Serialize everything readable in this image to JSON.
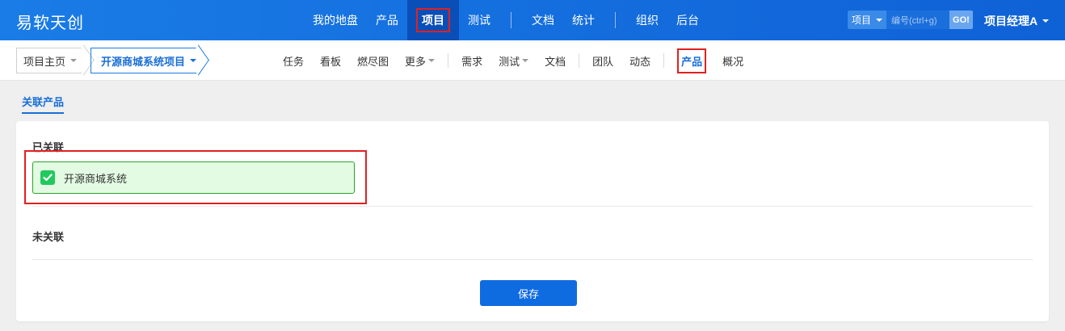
{
  "header": {
    "brand": "易软天创",
    "nav": [
      {
        "label": "我的地盘"
      },
      {
        "label": "产品"
      },
      {
        "label": "项目",
        "active": true
      },
      {
        "label": "测试"
      },
      {
        "label": "文档"
      },
      {
        "label": "统计"
      },
      {
        "label": "组织"
      },
      {
        "label": "后台"
      }
    ],
    "search": {
      "scope": "项目",
      "placeholder": "编号(ctrl+g)",
      "go": "GO!"
    },
    "user": "项目经理A",
    "colors": {
      "bar": "#1a7ce6",
      "active_bg": "#0a4fb8",
      "highlight": "#e02020"
    }
  },
  "subheader": {
    "crumb_home": "项目主页",
    "crumb_project": "开源商城系统项目",
    "nav": [
      {
        "label": "任务"
      },
      {
        "label": "看板"
      },
      {
        "label": "燃尽图"
      },
      {
        "label": "更多"
      },
      {
        "label": "需求"
      },
      {
        "label": "测试"
      },
      {
        "label": "文档"
      },
      {
        "label": "团队"
      },
      {
        "label": "动态"
      },
      {
        "label": "产品",
        "active": true
      },
      {
        "label": "概况"
      }
    ]
  },
  "tab": {
    "label": "关联产品"
  },
  "panel": {
    "linked_title": "已关联",
    "linked_items": [
      {
        "name": "开源商城系统",
        "checked": true
      }
    ],
    "unlinked_title": "未关联",
    "save_label": "保存",
    "colors": {
      "linked_bg": "#e3fbe3",
      "linked_border": "#2aa42a",
      "check": "#22c95e",
      "button": "#0f6be0"
    }
  }
}
